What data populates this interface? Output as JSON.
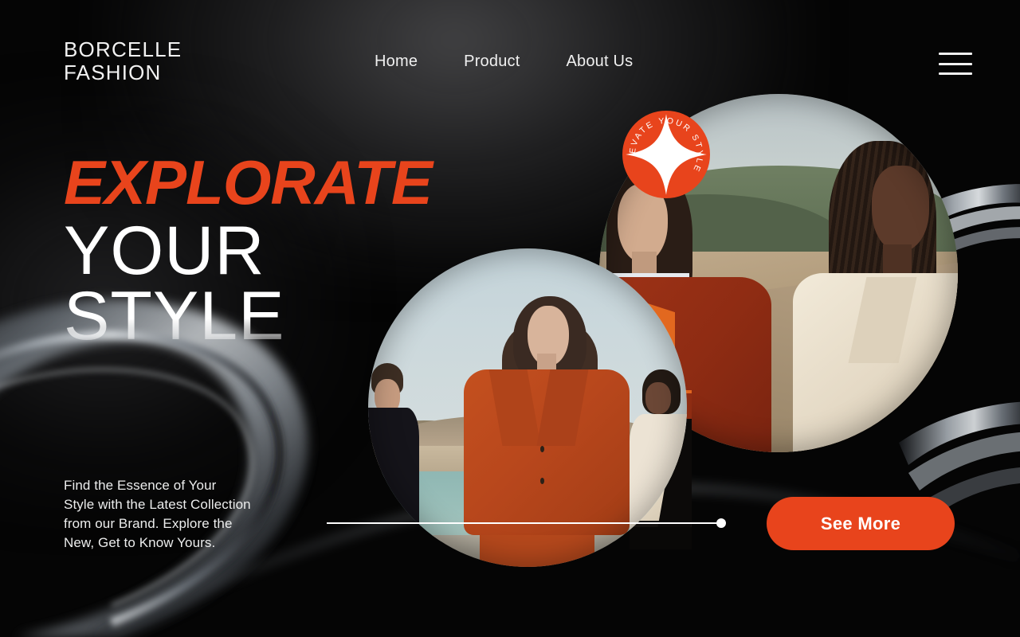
{
  "brand": {
    "logo_text": "BORCELLE\nFASHION"
  },
  "nav": {
    "items": [
      {
        "label": "Home"
      },
      {
        "label": "Product"
      },
      {
        "label": "About Us"
      }
    ],
    "menu_icon": "hamburger-menu-icon"
  },
  "hero": {
    "headline_line1": "EXPLORATE",
    "headline_line2": "YOUR",
    "headline_line3": "STYLE",
    "lede": "Find the Essence of Your\nStyle with the Latest Collection\nfrom our Brand. Explore the\nNew, Get to Know Yours."
  },
  "badge": {
    "text": "ELEVATE YOUR STYLE",
    "icon": "four-point-star-icon"
  },
  "slider": {
    "position_percent": 100
  },
  "cta": {
    "label": "See More"
  },
  "colors": {
    "accent": "#e8441c",
    "background": "#050505",
    "text": "#ffffff"
  }
}
